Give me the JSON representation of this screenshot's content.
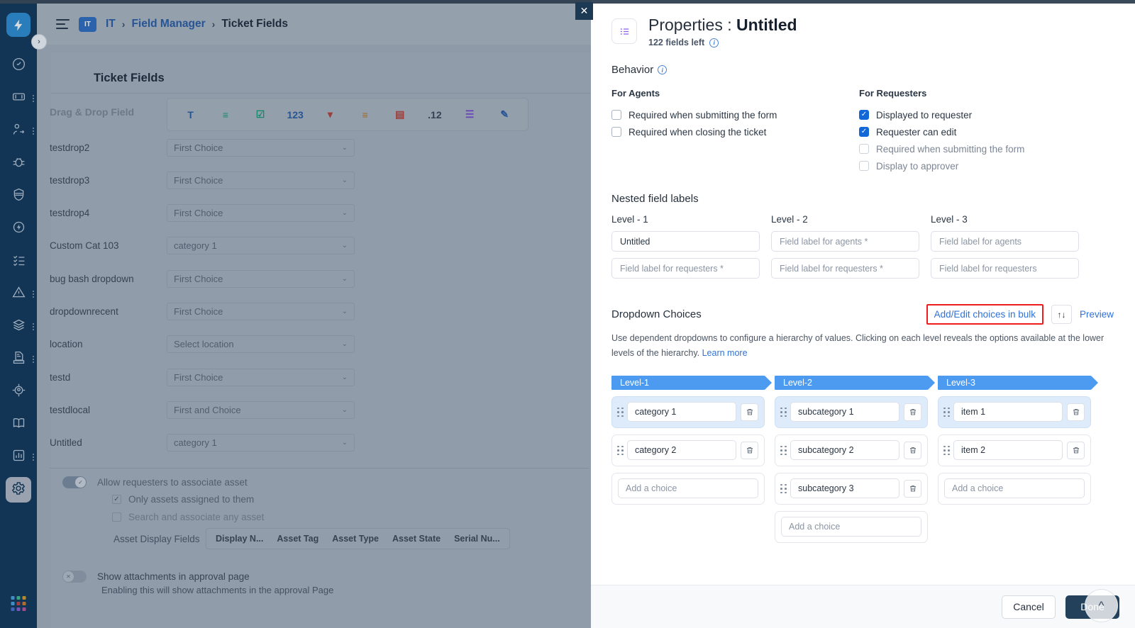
{
  "background": {
    "breadcrumb": {
      "badge": "IT",
      "workspace": "IT",
      "section": "Field Manager",
      "current": "Ticket Fields",
      "sep": "›"
    },
    "card_title": "Ticket Fields",
    "drag_drop_label": "Drag & Drop Field",
    "field_type_icons": [
      {
        "name": "text-field-icon",
        "glyph": "T",
        "color": "#2c5fa8"
      },
      {
        "name": "paragraph-field-icon",
        "glyph": "≡",
        "color": "#1a9e77"
      },
      {
        "name": "checkbox-field-icon",
        "glyph": "☑",
        "color": "#1a9e77"
      },
      {
        "name": "number-field-icon",
        "glyph": "123",
        "color": "#2c5fa8"
      },
      {
        "name": "dropdown-field-icon",
        "glyph": "▾",
        "color": "#b5443f"
      },
      {
        "name": "multiselect-field-icon",
        "glyph": "≡",
        "color": "#c0751f"
      },
      {
        "name": "date-field-icon",
        "glyph": "▤",
        "color": "#b5443f"
      },
      {
        "name": "decimal-field-icon",
        "glyph": ".12",
        "color": "#3b4a5a"
      },
      {
        "name": "dependent-field-icon",
        "glyph": "☰",
        "color": "#7a4fd0"
      },
      {
        "name": "rich-text-field-icon",
        "glyph": "✎",
        "color": "#2c5fa8"
      }
    ],
    "fields": [
      {
        "label": "testdrop2",
        "value": "First Choice"
      },
      {
        "label": "testdrop3",
        "value": "First Choice"
      },
      {
        "label": "testdrop4",
        "value": "First Choice"
      },
      {
        "label": "Custom Cat 103",
        "value": "category 1"
      },
      {
        "label": "bug bash dropdown",
        "value": "First Choice"
      },
      {
        "label": "dropdownrecent",
        "value": "First Choice"
      },
      {
        "label": "location",
        "value": "Select location"
      },
      {
        "label": "testd",
        "value": "First Choice"
      },
      {
        "label": "testdlocal",
        "value": "First and Choice"
      },
      {
        "label": "Untitled",
        "value": "category 1"
      }
    ],
    "asset_section": {
      "allow_toggle_label": "Allow requesters to associate asset",
      "allow_toggle_on": true,
      "sub_options": [
        {
          "label": "Only assets assigned to them",
          "checked": true
        },
        {
          "label": "Search and associate any asset",
          "checked": false
        }
      ],
      "asset_display_fields_label": "Asset Display Fields",
      "asset_display_chips": [
        "Display N...",
        "Asset Tag",
        "Asset Type",
        "Asset State",
        "Serial Nu..."
      ],
      "attachments_toggle_label": "Show attachments in approval page",
      "attachments_toggle_on": false,
      "attachments_help": "Enabling this will show attachments in the approval Page"
    },
    "sidebar_icons": [
      "dashboard-icon",
      "ticket-icon",
      "user-transfer-icon",
      "bug-icon",
      "shield-icon",
      "automation-icon",
      "task-list-icon",
      "alert-icon",
      "layers-icon",
      "document-icon",
      "asset-target-icon",
      "knowledge-book-icon",
      "analytics-icon",
      "gear-icon"
    ],
    "grid_colors": [
      "#4aa3e0",
      "#3fbf8f",
      "#d99a2b",
      "#4aa3e0",
      "#c0443e",
      "#d07a2a",
      "#4a6fd0",
      "#8e5fd0",
      "#c0559b"
    ],
    "close_label": "✕",
    "expand_chevron": "›"
  },
  "panel": {
    "header": {
      "title_prefix": "Properties : ",
      "title_value": "Untitled",
      "fields_left": "122 fields left"
    },
    "behavior": {
      "section_label": "Behavior",
      "agents": {
        "heading": "For Agents",
        "items": [
          {
            "label": "Required when submitting the form",
            "checked": false,
            "disabled": false
          },
          {
            "label": "Required when closing the ticket",
            "checked": false,
            "disabled": false
          }
        ]
      },
      "requesters": {
        "heading": "For Requesters",
        "items": [
          {
            "label": "Displayed to requester",
            "checked": true,
            "disabled": false
          },
          {
            "label": "Requester can edit",
            "checked": true,
            "disabled": false
          },
          {
            "label": "Required when submitting the form",
            "checked": false,
            "disabled": true
          },
          {
            "label": "Display to approver",
            "checked": false,
            "disabled": true
          }
        ]
      }
    },
    "nested_labels": {
      "section_label": "Nested field labels",
      "columns": [
        {
          "level_label": "Level - 1",
          "agent_value": "Untitled",
          "agent_is_value": true,
          "requester_placeholder": "Field label for requesters *"
        },
        {
          "level_label": "Level - 2",
          "agent_value": "Field label for agents *",
          "agent_is_value": false,
          "requester_placeholder": "Field label for requesters *"
        },
        {
          "level_label": "Level - 3",
          "agent_value": "Field label for agents",
          "agent_is_value": false,
          "requester_placeholder": "Field label for requesters"
        }
      ]
    },
    "dropdown_choices": {
      "title": "Dropdown Choices",
      "bulk_button": "Add/Edit choices in bulk",
      "sort_button": "↑↓",
      "preview_link": "Preview",
      "description": "Use dependent dropdowns to configure a hierarchy of values. Clicking on each level reveals the options available at the lower levels of the hierarchy. ",
      "learn_more": "Learn more",
      "highlight_color": "#f01c1c",
      "levels": [
        {
          "header": "Level-1",
          "choices": [
            {
              "value": "category 1",
              "selected": true
            },
            {
              "value": "category 2",
              "selected": false
            }
          ],
          "add_placeholder": "Add a choice",
          "add_has_handle": false
        },
        {
          "header": "Level-2",
          "choices": [
            {
              "value": "subcategory 1",
              "selected": true
            },
            {
              "value": "subcategory 2",
              "selected": false
            },
            {
              "value": "subcategory 3",
              "selected": false
            }
          ],
          "add_placeholder": "Add a choice",
          "add_has_handle": false
        },
        {
          "header": "Level-3",
          "choices": [
            {
              "value": "item 1",
              "selected": true
            },
            {
              "value": "item 2",
              "selected": false
            }
          ],
          "add_placeholder": "Add a choice",
          "add_has_handle": false
        }
      ]
    },
    "footer": {
      "cancel": "Cancel",
      "done": "Done",
      "scroll_top": "^"
    }
  }
}
